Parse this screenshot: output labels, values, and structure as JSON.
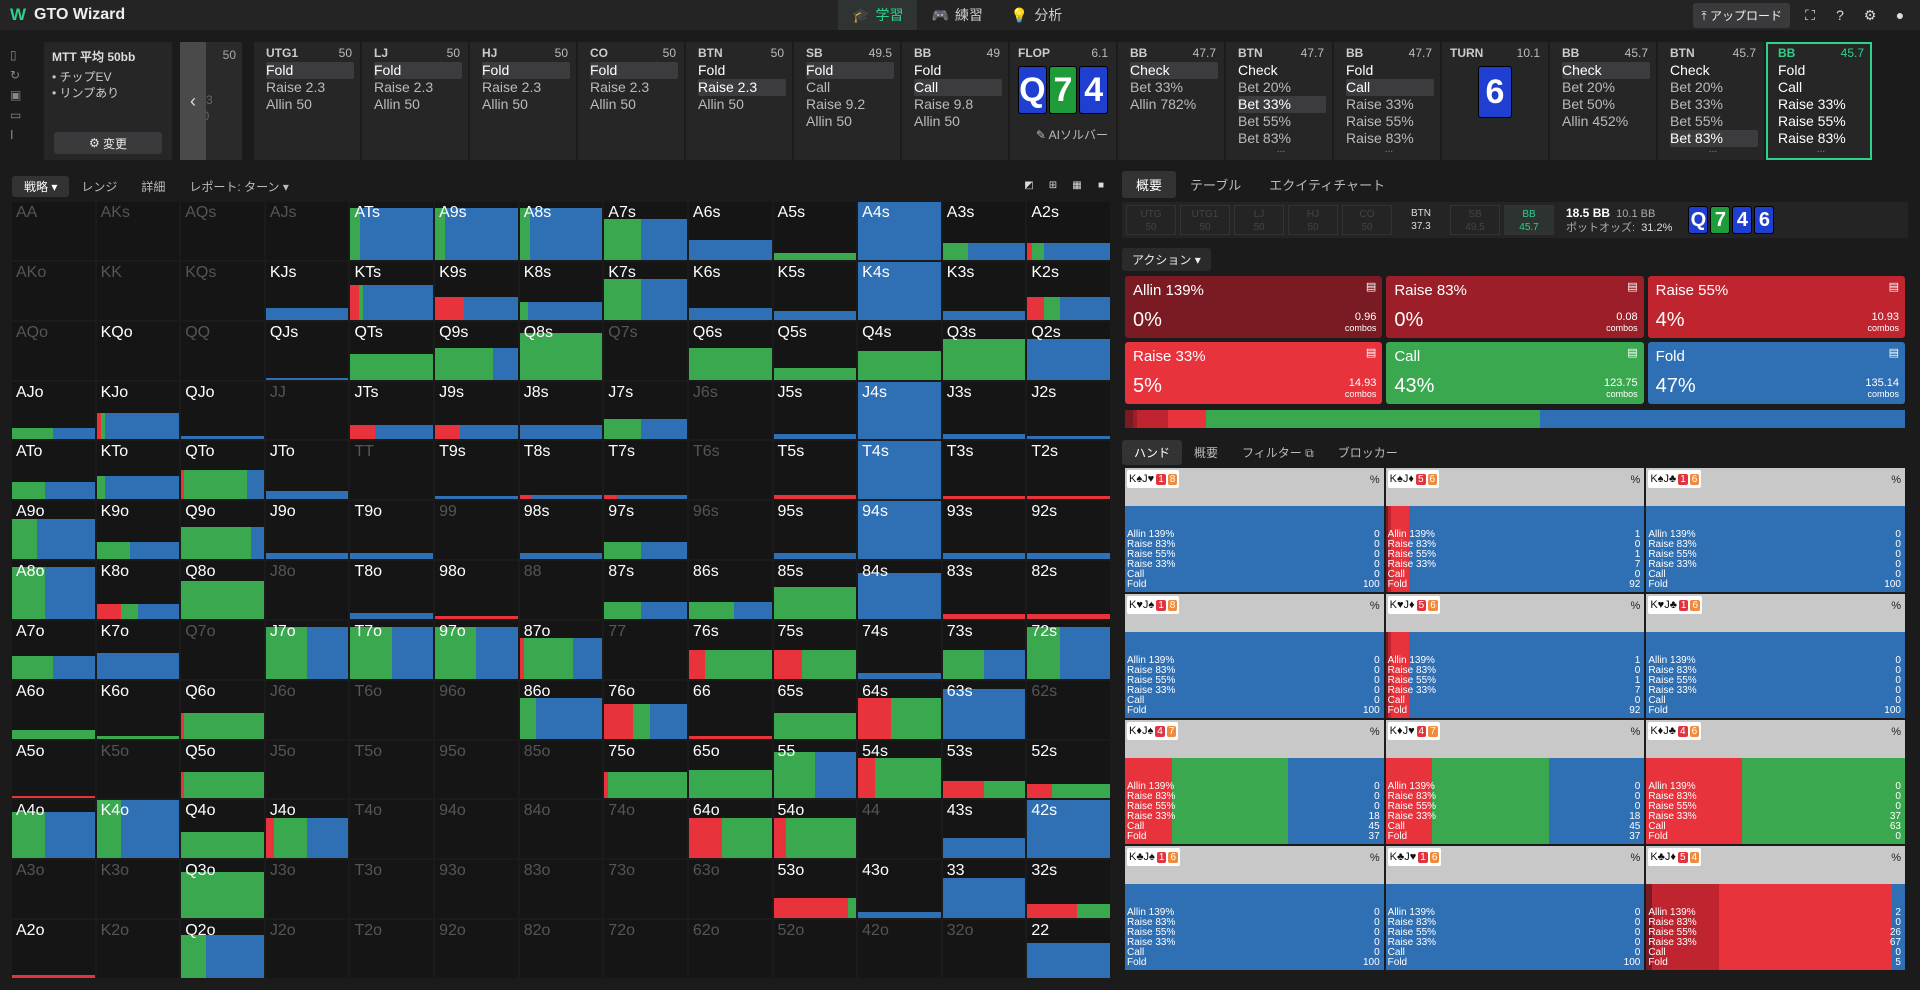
{
  "app": {
    "title": "GTO Wizard",
    "upload": "アップロード"
  },
  "nav": [
    {
      "label": "学習",
      "icon": "graduation-cap-icon"
    },
    {
      "label": "練習",
      "icon": "gamepad-icon"
    },
    {
      "label": "分析",
      "icon": "bulb-icon"
    }
  ],
  "mtt": {
    "title": "MTT 平均 50bb",
    "bullets": [
      "• チップEV",
      "• リンプあり"
    ],
    "change": "変更"
  },
  "collapsed": {
    "bb": "50",
    "lines": [
      "2.3",
      "50"
    ]
  },
  "positions": [
    {
      "name": "UTG1",
      "bb": "50",
      "opts": [
        "Fold",
        "Raise 2.3",
        "Allin 50"
      ],
      "sel": 0
    },
    {
      "name": "LJ",
      "bb": "50",
      "opts": [
        "Fold",
        "Raise 2.3",
        "Allin 50"
      ],
      "sel": 0
    },
    {
      "name": "HJ",
      "bb": "50",
      "opts": [
        "Fold",
        "Raise 2.3",
        "Allin 50"
      ],
      "sel": 0
    },
    {
      "name": "CO",
      "bb": "50",
      "opts": [
        "Fold",
        "Raise 2.3",
        "Allin 50"
      ],
      "sel": 0
    },
    {
      "name": "BTN",
      "bb": "50",
      "opts": [
        "Fold",
        "Raise 2.3",
        "Allin 50"
      ],
      "sel": 1
    },
    {
      "name": "SB",
      "bb": "49.5",
      "opts": [
        "Fold",
        "Call",
        "Raise 9.2",
        "Allin 50"
      ],
      "sel": 0
    },
    {
      "name": "BB",
      "bb": "49",
      "opts": [
        "Fold",
        "Call",
        "Raise 9.8",
        "Allin 50"
      ],
      "sel": 1
    }
  ],
  "flop": {
    "label": "FLOP",
    "pot": "6.1",
    "cards": [
      "Q",
      "7",
      "4"
    ],
    "solver": "AIソルバー"
  },
  "postflop": [
    {
      "name": "BB",
      "bb": "47.7",
      "opts": [
        "Check",
        "Bet 33%",
        "Allin 782%"
      ],
      "sel": 0
    },
    {
      "name": "BTN",
      "bb": "47.7",
      "opts": [
        "Check",
        "Bet 20%",
        "Bet 33%",
        "Bet 55%",
        "Bet 83%"
      ],
      "sel": 2
    },
    {
      "name": "BB",
      "bb": "47.7",
      "opts": [
        "Fold",
        "Call",
        "Raise 33%",
        "Raise 55%",
        "Raise 83%"
      ],
      "sel": 1
    }
  ],
  "turn": {
    "label": "TURN",
    "pot": "10.1",
    "card": "6"
  },
  "postturn": [
    {
      "name": "BB",
      "bb": "45.7",
      "opts": [
        "Check",
        "Bet 20%",
        "Bet 50%",
        "Allin 452%"
      ],
      "sel": 0
    },
    {
      "name": "BTN",
      "bb": "45.7",
      "opts": [
        "Check",
        "Bet 20%",
        "Bet 33%",
        "Bet 55%",
        "Bet 83%"
      ],
      "sel": 4
    },
    {
      "name": "BB",
      "bb": "45.7",
      "opts": [
        "Fold",
        "Call",
        "Raise 33%",
        "Raise 55%",
        "Raise 83%"
      ],
      "sel": -1
    }
  ],
  "left_tabs": [
    "戦略",
    "レンジ",
    "詳細",
    "レポート: ターン"
  ],
  "right_tabs": [
    "概要",
    "テーブル",
    "エクイティチャート"
  ],
  "seats": [
    {
      "n": "UTG",
      "v": "50"
    },
    {
      "n": "UTG1",
      "v": "50"
    },
    {
      "n": "LJ",
      "v": "50"
    },
    {
      "n": "HJ",
      "v": "50"
    },
    {
      "n": "CO",
      "v": "50"
    },
    {
      "n": "BTN",
      "v": "37.3"
    },
    {
      "n": "SB",
      "v": "49.5"
    },
    {
      "n": "BB",
      "v": "45.7"
    }
  ],
  "pot": {
    "bb": "18.5 BB",
    "bb2": "10.1 BB",
    "odds_label": "ポットオッズ:",
    "odds": "31.2%"
  },
  "action_label": "アクション",
  "actions": [
    {
      "name": "Allin 139%",
      "pct": "0%",
      "combos": "0.96",
      "color": "#7a1a22"
    },
    {
      "name": "Raise 83%",
      "pct": "0%",
      "combos": "0.08",
      "color": "#9b1e28"
    },
    {
      "name": "Raise 55%",
      "pct": "4%",
      "combos": "10.93",
      "color": "#c0242e"
    },
    {
      "name": "Raise 33%",
      "pct": "5%",
      "combos": "14.93",
      "color": "#e8323c"
    },
    {
      "name": "Call",
      "pct": "43%",
      "combos": "123.75",
      "color": "#3aa84f"
    },
    {
      "name": "Fold",
      "pct": "47%",
      "combos": "135.14",
      "color": "#2f6fb3"
    }
  ],
  "combos_label": "combos",
  "hand_tabs": [
    "ハンド",
    "概要",
    "フィルター",
    "ブロッカー"
  ],
  "hand_rows": [
    "Allin 139%",
    "Raise 83%",
    "Raise 55%",
    "Raise 33%",
    "Call",
    "Fold"
  ],
  "hands": [
    {
      "c": "K♠J♥",
      "b1": "1",
      "b2": "8",
      "v": [
        0,
        0,
        0,
        0,
        0,
        100
      ]
    },
    {
      "c": "K♠J♦",
      "b1": "5",
      "b2": "6",
      "v": [
        1,
        0,
        1,
        7,
        0,
        92
      ]
    },
    {
      "c": "K♠J♣",
      "b1": "1",
      "b2": "6",
      "v": [
        0,
        0,
        0,
        0,
        0,
        100
      ]
    },
    {
      "c": "K♥J♠",
      "b1": "1",
      "b2": "8",
      "v": [
        0,
        0,
        0,
        0,
        0,
        100
      ]
    },
    {
      "c": "K♥J♦",
      "b1": "5",
      "b2": "6",
      "v": [
        1,
        0,
        1,
        7,
        0,
        92
      ]
    },
    {
      "c": "K♥J♣",
      "b1": "1",
      "b2": "6",
      "v": [
        0,
        0,
        0,
        0,
        0,
        100
      ]
    },
    {
      "c": "K♦J♠",
      "b1": "4",
      "b2": "7",
      "v": [
        0,
        0,
        0,
        18,
        45,
        37
      ]
    },
    {
      "c": "K♦J♥",
      "b1": "4",
      "b2": "7",
      "v": [
        0,
        0,
        0,
        18,
        45,
        37
      ]
    },
    {
      "c": "K♦J♣",
      "b1": "4",
      "b2": "6",
      "v": [
        0,
        0,
        0,
        37,
        63,
        0
      ]
    },
    {
      "c": "K♣J♠",
      "b1": "1",
      "b2": "6",
      "v": [
        0,
        0,
        0,
        0,
        0,
        100
      ]
    },
    {
      "c": "K♣J♥",
      "b1": "1",
      "b2": "6",
      "v": [
        0,
        0,
        0,
        0,
        0,
        100
      ]
    },
    {
      "c": "K♣J♦",
      "b1": "5",
      "b2": "4",
      "v": [
        2,
        0,
        26,
        67,
        0,
        5
      ]
    }
  ],
  "matrix": [
    [
      "AA",
      "AKs",
      "AQs",
      "AJs",
      "ATs",
      "A9s",
      "A8s",
      "A7s",
      "A6s",
      "A5s",
      "A4s",
      "A3s",
      "A2s"
    ],
    [
      "AKo",
      "KK",
      "KQs",
      "KJs",
      "KTs",
      "K9s",
      "K8s",
      "K7s",
      "K6s",
      "K5s",
      "K4s",
      "K3s",
      "K2s"
    ],
    [
      "AQo",
      "KQo",
      "QQ",
      "QJs",
      "QTs",
      "Q9s",
      "Q8s",
      "Q7s",
      "Q6s",
      "Q5s",
      "Q4s",
      "Q3s",
      "Q2s"
    ],
    [
      "AJo",
      "KJo",
      "QJo",
      "JJ",
      "JTs",
      "J9s",
      "J8s",
      "J7s",
      "J6s",
      "J5s",
      "J4s",
      "J3s",
      "J2s"
    ],
    [
      "ATo",
      "KTo",
      "QTo",
      "JTo",
      "TT",
      "T9s",
      "T8s",
      "T7s",
      "T6s",
      "T5s",
      "T4s",
      "T3s",
      "T2s"
    ],
    [
      "A9o",
      "K9o",
      "Q9o",
      "J9o",
      "T9o",
      "99",
      "98s",
      "97s",
      "96s",
      "95s",
      "94s",
      "93s",
      "92s"
    ],
    [
      "A8o",
      "K8o",
      "Q8o",
      "J8o",
      "T8o",
      "98o",
      "88",
      "87s",
      "86s",
      "85s",
      "84s",
      "83s",
      "82s"
    ],
    [
      "A7o",
      "K7o",
      "Q7o",
      "J7o",
      "T7o",
      "97o",
      "87o",
      "77",
      "76s",
      "75s",
      "74s",
      "73s",
      "72s"
    ],
    [
      "A6o",
      "K6o",
      "Q6o",
      "J6o",
      "T6o",
      "96o",
      "86o",
      "76o",
      "66",
      "65s",
      "64s",
      "63s",
      "62s"
    ],
    [
      "A5o",
      "K5o",
      "Q5o",
      "J5o",
      "T5o",
      "95o",
      "85o",
      "75o",
      "65o",
      "55",
      "54s",
      "53s",
      "52s"
    ],
    [
      "A4o",
      "K4o",
      "Q4o",
      "J4o",
      "T4o",
      "94o",
      "84o",
      "74o",
      "64o",
      "54o",
      "44",
      "43s",
      "42s"
    ],
    [
      "A3o",
      "K3o",
      "Q3o",
      "J3o",
      "T3o",
      "93o",
      "83o",
      "73o",
      "63o",
      "53o",
      "43o",
      "33",
      "32s"
    ],
    [
      "A2o",
      "K2o",
      "Q2o",
      "J2o",
      "T2o",
      "92o",
      "82o",
      "72o",
      "62o",
      "52o",
      "42o",
      "32o",
      "22"
    ]
  ],
  "colors": {
    "accent": "#2fd08a",
    "fold": "#2f6fb3",
    "call": "#3aa84f",
    "raise": "#e8323c",
    "allin": "#7a1a22"
  }
}
